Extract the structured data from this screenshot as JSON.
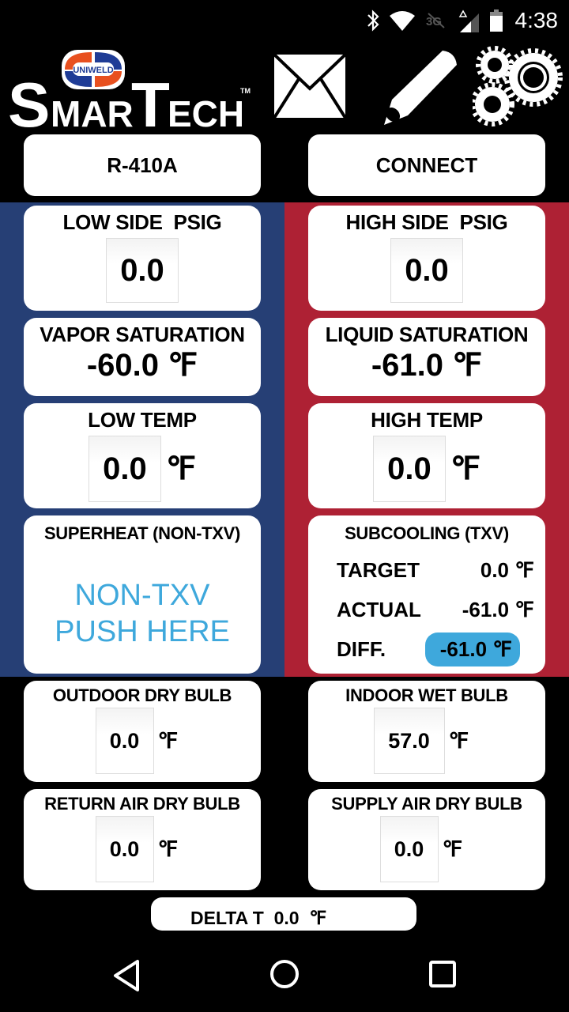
{
  "status_bar": {
    "time": "4:38",
    "icons": [
      "bluetooth-icon",
      "wifi-icon",
      "3g-icon",
      "signal-icon",
      "battery-icon"
    ],
    "network_label": "3G"
  },
  "header": {
    "brand_badge": "UNIWELD",
    "brand_name": "SMARTECH",
    "trademark": "TM",
    "icons": [
      "mail-icon",
      "pencil-icon",
      "settings-gears-icon"
    ]
  },
  "top_buttons": {
    "refrigerant": "R-410A",
    "connect": "CONNECT"
  },
  "colors": {
    "low_side": "#263f75",
    "high_side": "#ae2134",
    "accent": "#3ea8dc"
  },
  "low_side": {
    "psig": {
      "title": "LOW SIDE  PSIG",
      "value": "0.0"
    },
    "saturation": {
      "title": "VAPOR SATURATION",
      "value": "-60.0 ℉"
    },
    "temp": {
      "title": "LOW TEMP",
      "value": "0.0",
      "unit": "℉"
    },
    "superheat": {
      "title": "SUPERHEAT (NON-TXV)",
      "line1": "NON-TXV",
      "line2": "PUSH HERE"
    }
  },
  "high_side": {
    "psig": {
      "title": "HIGH SIDE  PSIG",
      "value": "0.0"
    },
    "saturation": {
      "title": "LIQUID SATURATION",
      "value": "-61.0 ℉"
    },
    "temp": {
      "title": "HIGH TEMP",
      "value": "0.0",
      "unit": "℉"
    },
    "subcooling": {
      "title": "SUBCOOLING (TXV)",
      "rows": [
        {
          "label": "TARGET",
          "value": "0.0 ℉"
        },
        {
          "label": "ACTUAL",
          "value": "-61.0 ℉"
        },
        {
          "label": "DIFF.",
          "value": "-61.0 ℉"
        }
      ]
    }
  },
  "air": {
    "outdoor_dry_bulb": {
      "title": "OUTDOOR DRY BULB",
      "value": "0.0",
      "unit": "℉"
    },
    "indoor_wet_bulb": {
      "title": "INDOOR WET BULB",
      "value": "57.0",
      "unit": "℉"
    },
    "return_air_dry_bulb": {
      "title": "RETURN AIR DRY BULB",
      "value": "0.0",
      "unit": "℉"
    },
    "supply_air_dry_bulb": {
      "title": "SUPPLY AIR DRY BULB",
      "value": "0.0",
      "unit": "℉"
    },
    "delta_t": "DELTA T  0.0  ℉"
  },
  "nav_bar": [
    "back-icon",
    "home-icon",
    "recents-icon"
  ]
}
